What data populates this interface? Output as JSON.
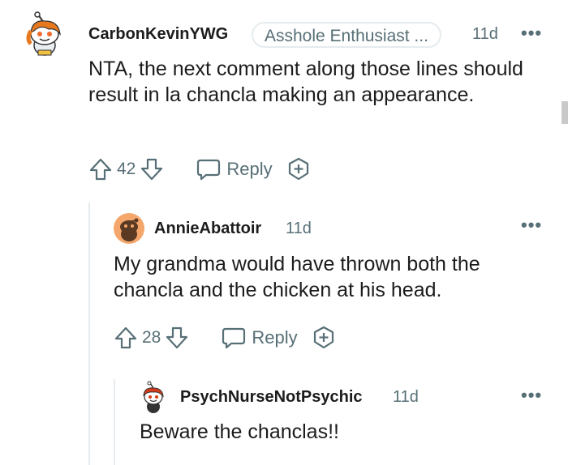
{
  "comments": [
    {
      "username": "CarbonKevinYWG",
      "flair": "Asshole Enthusiast ...",
      "time": "11d",
      "body": "NTA, the next comment along those lines should result in la chancla making an appearance.",
      "votes": "42",
      "reply_label": "Reply",
      "avatar_icon": "snoo-avatar-orange-hair-icon"
    },
    {
      "username": "AnnieAbattoir",
      "time": "11d",
      "body": "My grandma would have thrown both the chancla and the chicken at his head.",
      "votes": "28",
      "reply_label": "Reply",
      "avatar_icon": "default-avatar-icon"
    },
    {
      "username": "PsychNurseNotPsychic",
      "time": "11d",
      "body": "Beware the chanclas!!",
      "avatar_icon": "snoo-avatar-red-hair-icon"
    }
  ],
  "more_label": "•••",
  "colors": {
    "meta": "#576f76",
    "text": "#1c1c1c",
    "thread_line": "#e5ebee",
    "avatar_orange": "#f5a66a"
  }
}
